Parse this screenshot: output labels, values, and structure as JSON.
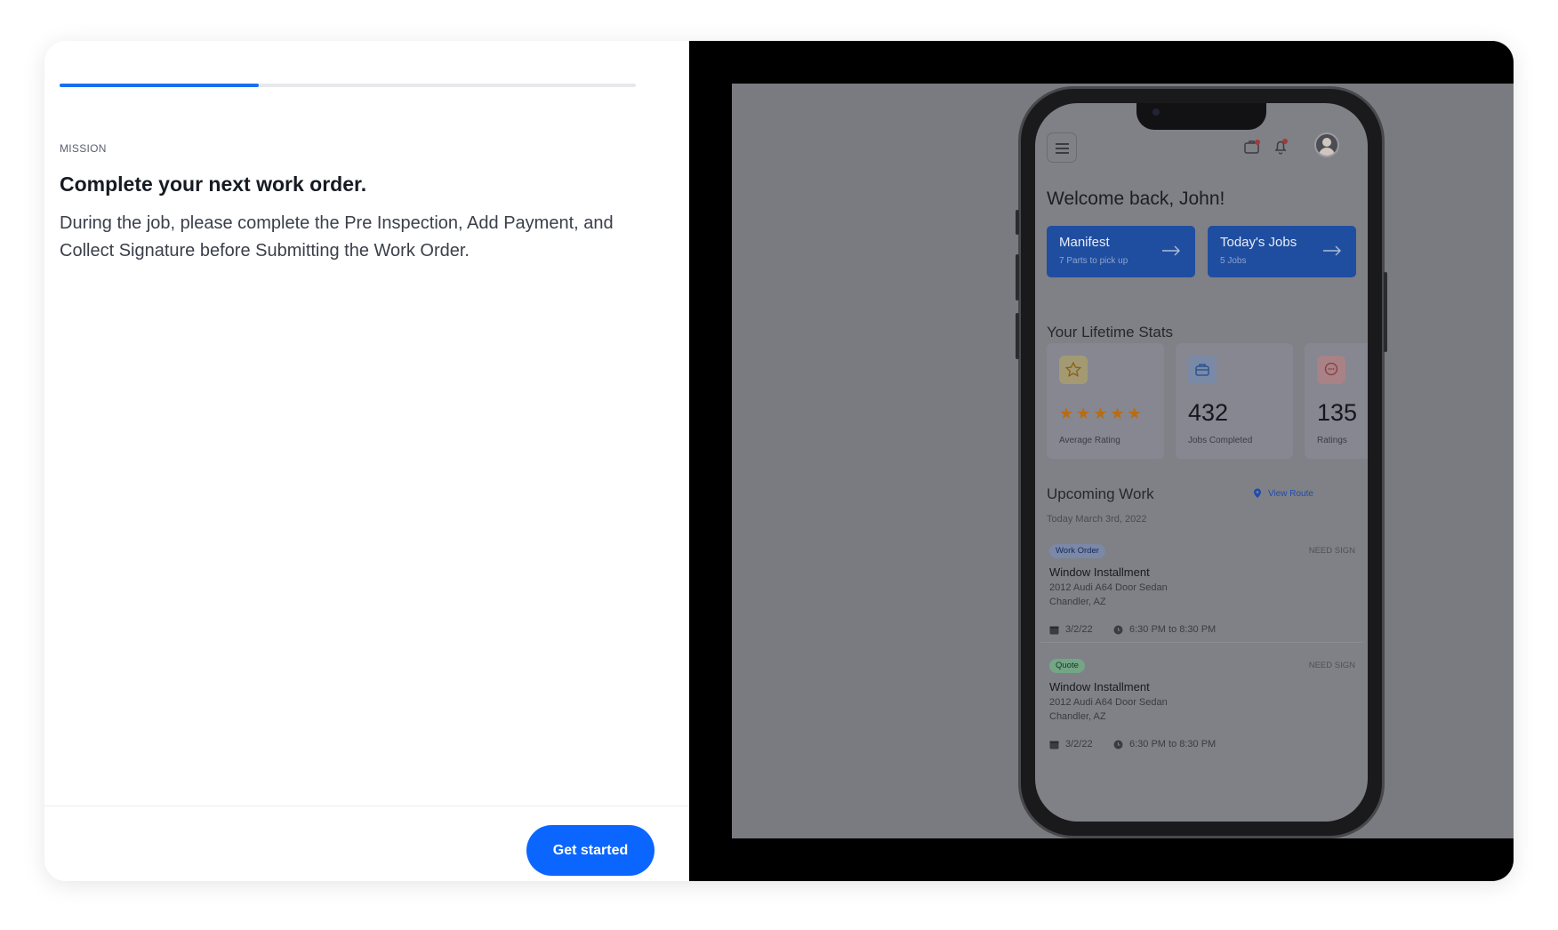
{
  "progress": {
    "fraction": 0.345
  },
  "panel": {
    "eyebrow": "MISSION",
    "title": "Complete your next work order.",
    "description": "During the job, please complete the Pre Inspection, Add Payment, and Collect Signature before Submitting the Work Order.",
    "cta_label": "Get started"
  },
  "phone": {
    "icons": [
      "menu-icon",
      "briefcase-icon",
      "bell-icon",
      "avatar"
    ],
    "welcome": "Welcome back, John!",
    "tiles": [
      {
        "title": "Manifest",
        "subtitle": "7 Parts to pick up"
      },
      {
        "title": "Today's Jobs",
        "subtitle": "5 Jobs"
      }
    ],
    "stats_title": "Your Lifetime Stats",
    "stats": {
      "rating": {
        "stars": 5,
        "label": "Average Rating"
      },
      "jobs": {
        "value": "432",
        "label": "Jobs Completed"
      },
      "ratings": {
        "value": "135",
        "label": "Ratings"
      }
    },
    "upcoming_title": "Upcoming Work",
    "view_route": "View Route",
    "date": "Today March 3rd, 2022",
    "jobs": [
      {
        "badge": "Work Order",
        "status": "NEED SIGN",
        "title": "Window Installment",
        "vehicle": "2012 Audi A64 Door Sedan",
        "location": "Chandler, AZ",
        "date": "3/2/22",
        "time": "6:30 PM to 8:30 PM"
      },
      {
        "badge": "Quote",
        "status": "NEED SIGN",
        "title": "Window Installment",
        "vehicle": "2012 Audi A64 Door Sedan",
        "location": "Chandler, AZ",
        "date": "3/2/22",
        "time": "6:30 PM to 8:30 PM"
      }
    ]
  },
  "colors": {
    "accent": "#0a66ff",
    "tile": "#1f4ea0",
    "star": "#b96c13"
  }
}
